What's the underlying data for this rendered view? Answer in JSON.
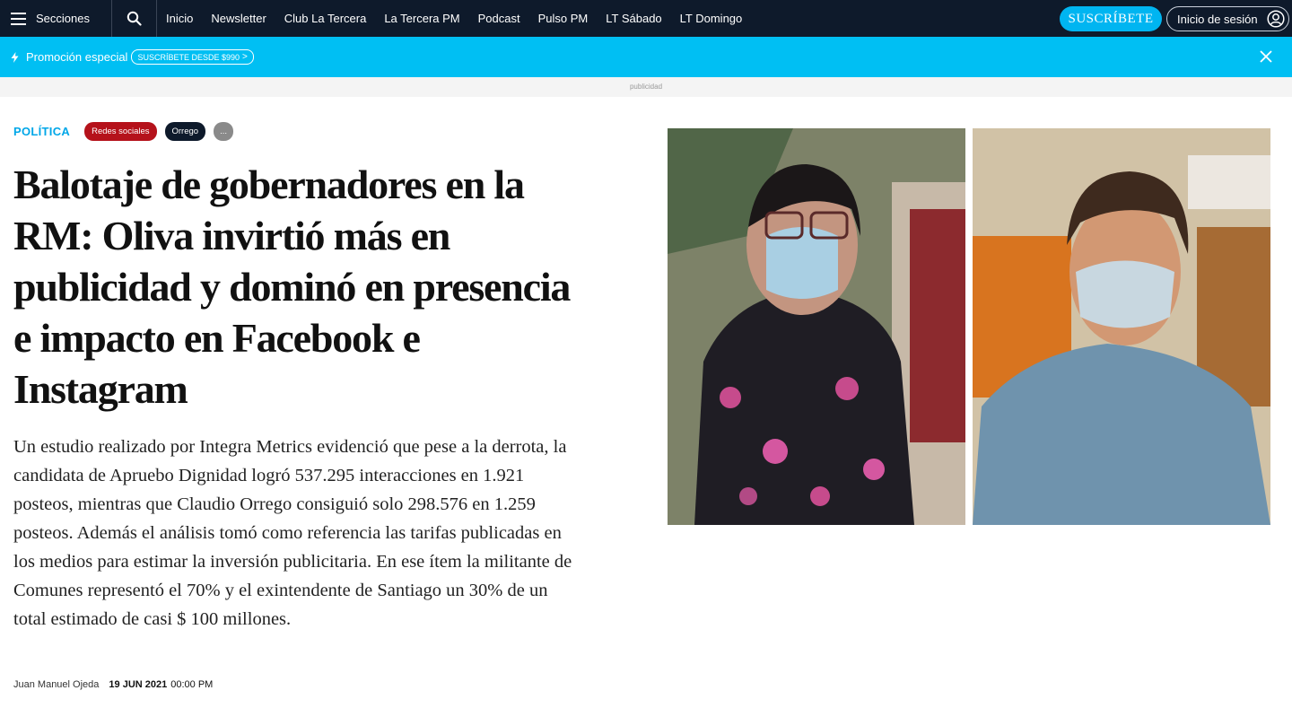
{
  "nav": {
    "sections_label": "Secciones",
    "links": [
      "Inicio",
      "Newsletter",
      "Club La Tercera",
      "La Tercera PM",
      "Podcast",
      "Pulso PM",
      "LT Sábado",
      "LT Domingo"
    ],
    "subscribe_label": "SUSCRÍBETE",
    "login_label": "Inicio de sesión"
  },
  "promo": {
    "text": "Promoción especial",
    "pill_label": "SUSCRÍBETE DESDE $990"
  },
  "ad_label": "publicidad",
  "article": {
    "section": "POLÍTICA",
    "tags": [
      "Redes sociales",
      "Orrego",
      "..."
    ],
    "headline": "Balotaje de gobernadores en la RM: Oliva invirtió más en publicidad y dominó en presencia e impacto en Facebook e Instagram",
    "lede": "Un estudio realizado por Integra Metrics evidenció que pese a la derrota, la candidata de Apruebo Dignidad logró 537.295 interacciones en 1.921 posteos, mientras que Claudio Orrego consiguió solo 298.576 en 1.259 posteos. Además el análisis tomó como referencia las tarifas publicadas en los medios para estimar la inversión publicitaria. En ese ítem la militante de Comunes representó el 70% y el exintendente de Santiago un 30% de un total estimado de casi $ 100 millones.",
    "author": "Juan Manuel Ojeda",
    "date": "19 JUN 2021",
    "time": "00:00 PM"
  },
  "colors": {
    "nav_bg": "#0e1a2b",
    "accent": "#00bff3",
    "section": "#00a7e8",
    "tag_red": "#b5121b"
  }
}
